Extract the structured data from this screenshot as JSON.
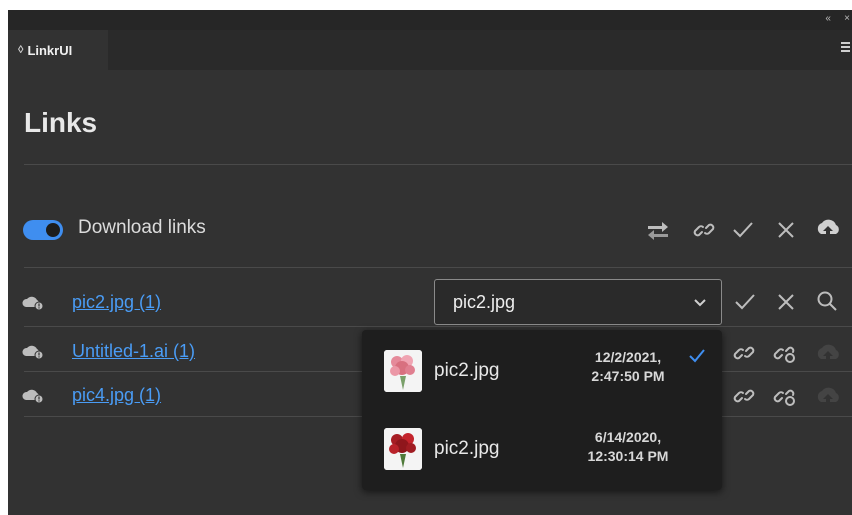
{
  "window": {
    "collapse_glyph": "‹‹",
    "close_glyph": "×"
  },
  "tab": {
    "chevron": "◊",
    "label": "LinkrUI"
  },
  "panel": {
    "title": "Links"
  },
  "toolbar": {
    "toggle_label": "Download links",
    "toggle_on": true,
    "icons": [
      "swap-arrows-icon",
      "link-icon",
      "check-icon",
      "close-icon",
      "cloud-upload-icon"
    ],
    "accent_color": "#3f8ef0"
  },
  "links": [
    {
      "name": "pic2.jpg (1)",
      "status_icon": "cloud-warning-icon"
    },
    {
      "name": "Untitled-1.ai (1)",
      "status_icon": "cloud-warning-icon"
    },
    {
      "name": "pic4.jpg (1)",
      "status_icon": "cloud-warning-icon"
    }
  ],
  "picker": {
    "selected": "pic2.jpg",
    "options": [
      {
        "name": "pic2.jpg",
        "date_line1": "12/2/2021,",
        "date_line2": "2:47:50 PM",
        "selected": true,
        "thumb_icon": "pink-roses-thumbnail"
      },
      {
        "name": "pic2.jpg",
        "date_line1": "6/14/2020,",
        "date_line2": "12:30:14 PM",
        "selected": false,
        "thumb_icon": "red-roses-thumbnail"
      }
    ]
  },
  "colors": {
    "link": "#4a9cf5",
    "panel_bg": "#323232",
    "popup_bg": "#1e1e1e"
  }
}
